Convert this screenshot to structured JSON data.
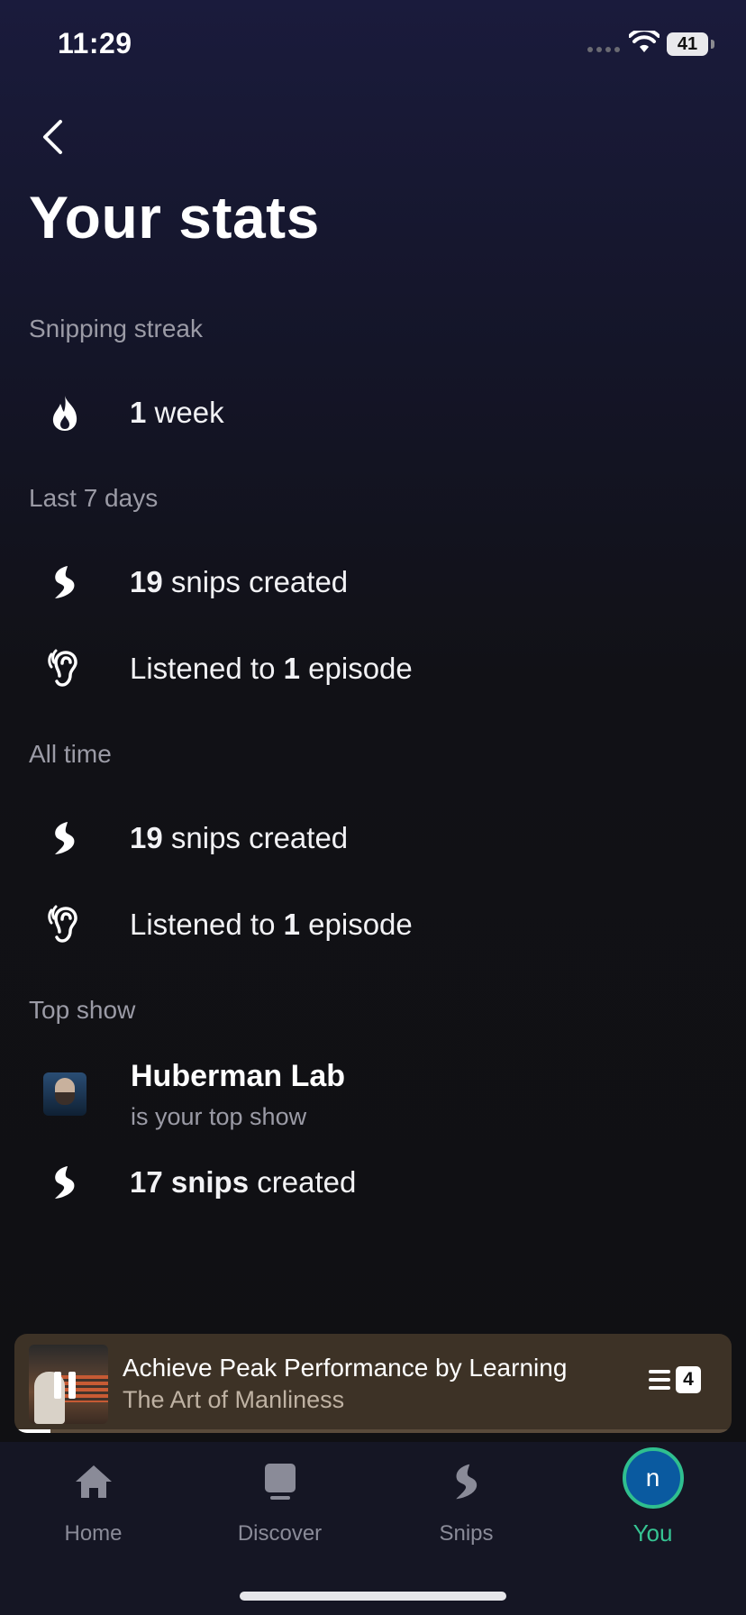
{
  "status_bar": {
    "time": "11:29",
    "battery": "41"
  },
  "page": {
    "title": "Your stats"
  },
  "sections": {
    "streak": {
      "label": "Snipping streak",
      "value": "1",
      "suffix": " week"
    },
    "last7": {
      "label": "Last 7 days",
      "snips_value": "19",
      "snips_suffix": " snips created",
      "listened_prefix": "Listened to ",
      "listened_value": "1",
      "listened_suffix": " episode"
    },
    "alltime": {
      "label": "All time",
      "snips_value": "19",
      "snips_suffix": " snips created",
      "listened_prefix": "Listened to ",
      "listened_value": "1",
      "listened_suffix": " episode"
    },
    "topshow": {
      "label": "Top show",
      "name": "Huberman Lab",
      "subtitle": "is your top show",
      "snips_value": "17 snips",
      "snips_suffix": " created"
    }
  },
  "now_playing": {
    "title": "Achieve Peak Performance by Learning",
    "show": "The Art of Manliness",
    "queue_count": "4",
    "progress_fraction": 0.05
  },
  "tabs": [
    {
      "label": "Home",
      "icon": "home-icon"
    },
    {
      "label": "Discover",
      "icon": "discover-icon"
    },
    {
      "label": "Snips",
      "icon": "snips-icon"
    },
    {
      "label": "You",
      "icon": "avatar",
      "avatar_letter": "n",
      "active": true
    }
  ],
  "colors": {
    "accent": "#36c493",
    "player_bg": "#3d3226",
    "avatar_bg": "#0a5aa0"
  }
}
